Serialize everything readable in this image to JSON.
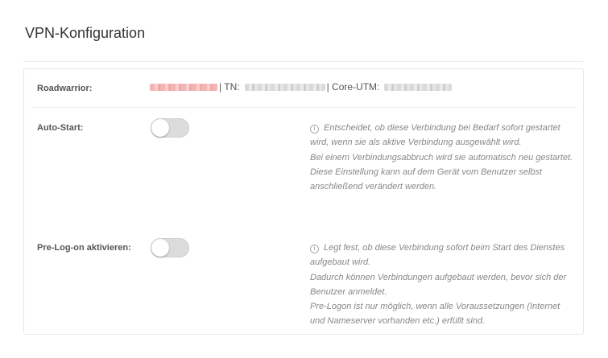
{
  "page": {
    "title": "VPN-Konfiguration"
  },
  "connection": {
    "label": "Roadwarrior:",
    "tn_label": "| TN:",
    "core_label": "| Core-UTM:"
  },
  "autostart": {
    "label": "Auto-Start:",
    "enabled": false,
    "help": [
      "Entscheidet, ob diese Verbindung bei Bedarf sofort gestartet wird, wenn sie als aktive Verbindung ausgewählt wird.",
      "Bei einem Verbindungsabbruch wird sie automatisch neu gestartet.",
      "Diese Einstellung kann auf dem Gerät vom Benutzer selbst anschließend verändert werden."
    ]
  },
  "prelogon": {
    "label": "Pre-Log-on aktivieren:",
    "enabled": false,
    "help": [
      "Legt fest, ob diese Verbindung sofort beim Start des Dienstes aufgebaut wird.",
      "Dadurch können Verbindungen aufgebaut werden, bevor sich der Benutzer anmeldet.",
      "Pre-Logon ist nur möglich, wenn alle Voraussetzungen (Internet und Nameserver vorhanden etc.) erfüllt sind."
    ]
  },
  "icons": {
    "info": "info-circle-icon"
  },
  "colors": {
    "toggle_off": "#dcdcdc",
    "help_text": "#888888",
    "redacted_user": "#f3b4b4",
    "redacted_value": "#d9d9d9"
  }
}
